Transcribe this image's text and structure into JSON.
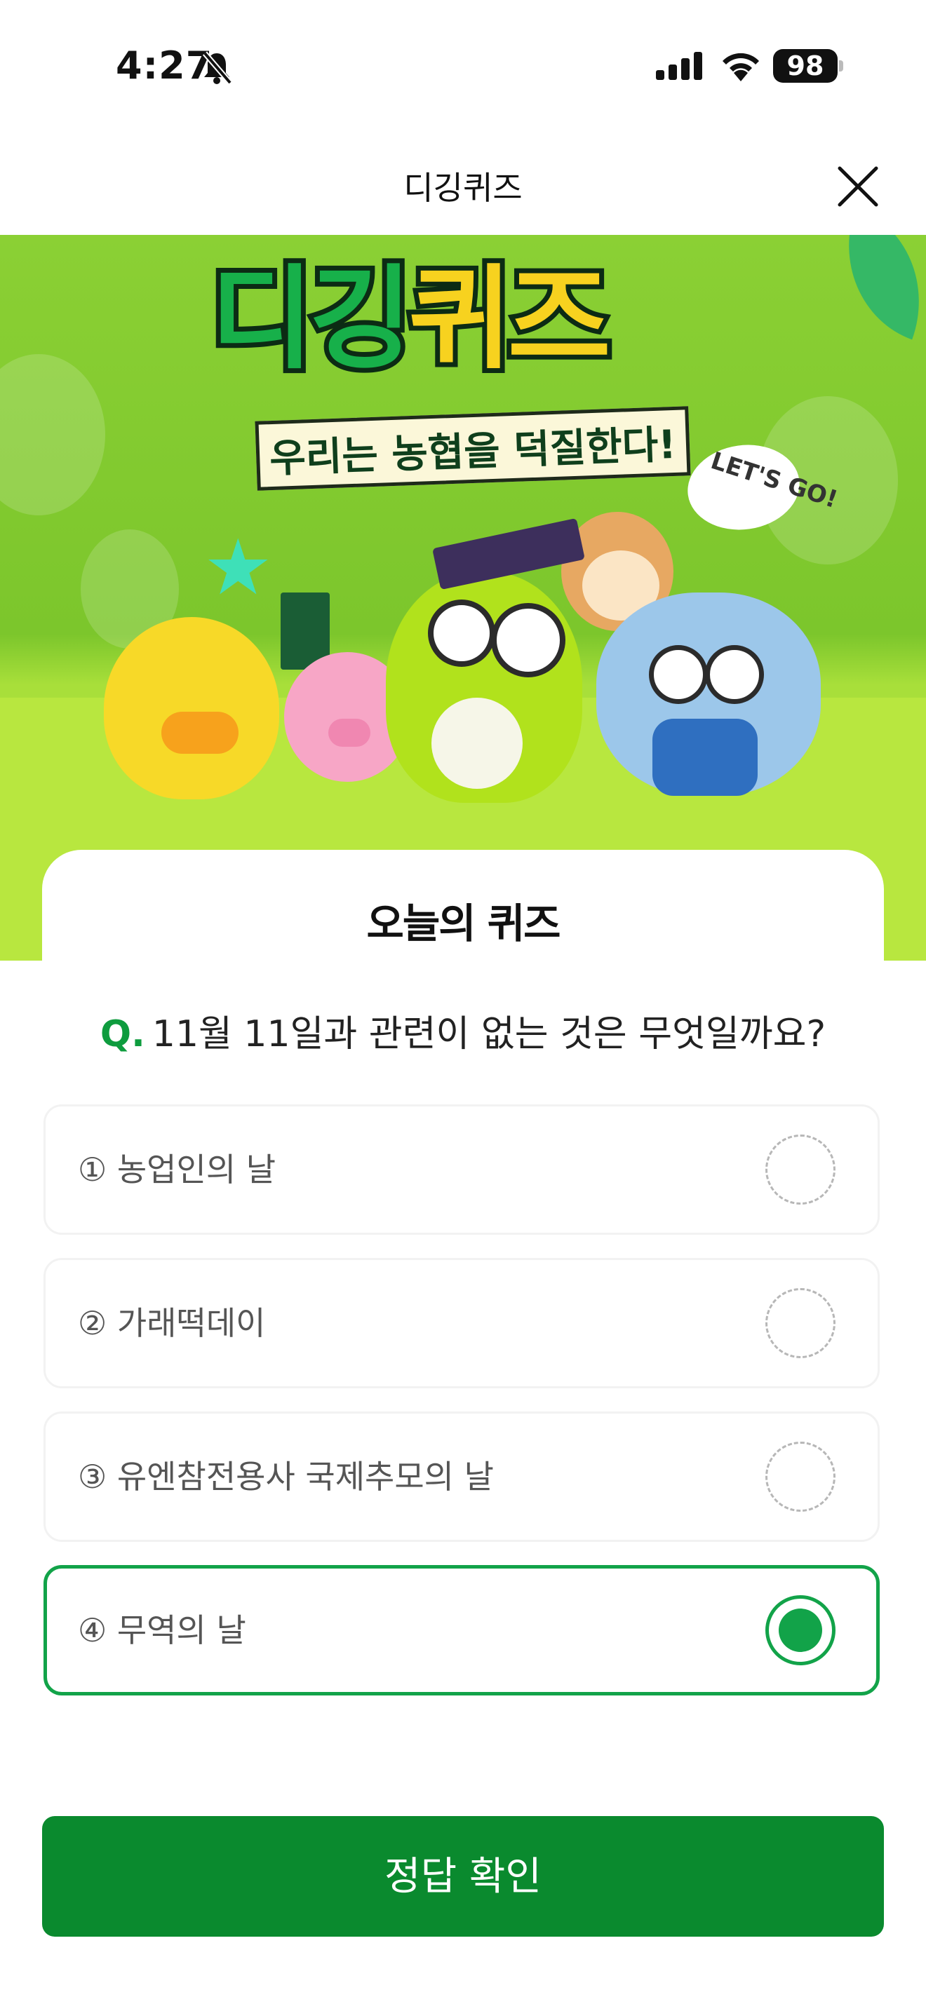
{
  "status_bar": {
    "time": "4:27",
    "battery": "98"
  },
  "nav": {
    "title": "디깅퀴즈"
  },
  "banner": {
    "logo_part1": "디깅",
    "logo_part2": "퀴즈",
    "slogan": "우리는 농협을 덕질한다!",
    "bubble": "LET'S GO!"
  },
  "quiz": {
    "heading": "오늘의 퀴즈",
    "question_prefix": "Q.",
    "question": "11월 11일과 관련이 없는 것은 무엇일까요?",
    "options": [
      {
        "label": "① 농업인의 날",
        "selected": false
      },
      {
        "label": "② 가래떡데이",
        "selected": false
      },
      {
        "label": "③ 유엔참전용사 국제추모의 날",
        "selected": false
      },
      {
        "label": "④ 무역의 날",
        "selected": true
      }
    ],
    "submit_label": "정답 확인"
  },
  "colors": {
    "accent": "#12a349",
    "button": "#0a8a2e",
    "banner": "#8bd034"
  },
  "icons": [
    "bell-muted-icon",
    "signal-icon",
    "wifi-icon",
    "battery-icon",
    "close-icon"
  ]
}
